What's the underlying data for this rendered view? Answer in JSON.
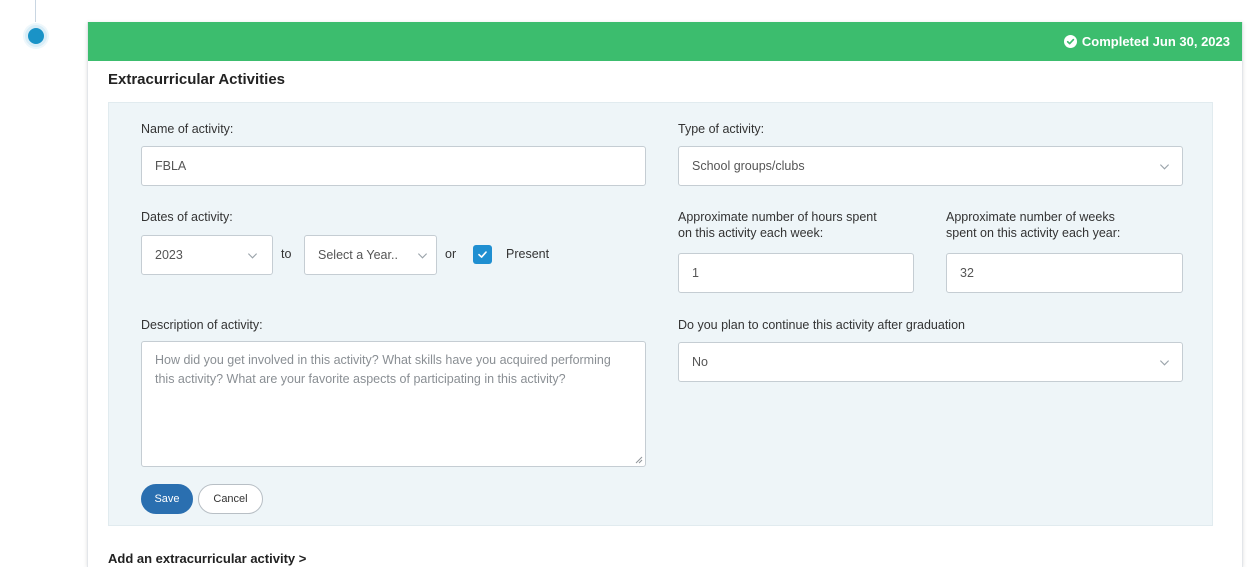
{
  "status": {
    "label": "Completed Jun 30, 2023",
    "color": "#3cbd6e",
    "icon": "check-circle-icon"
  },
  "section": {
    "title": "Extracurricular Activities"
  },
  "form": {
    "name": {
      "label": "Name of activity:",
      "value": "FBLA"
    },
    "type": {
      "label": "Type of activity:",
      "value": "School groups/clubs"
    },
    "dates": {
      "label": "Dates of activity:",
      "start_value": "2023",
      "to_text": "to",
      "end_placeholder": "Select a Year..",
      "or_text": "or",
      "present_label": "Present",
      "present_checked": true
    },
    "hours": {
      "label_line1": "Approximate number of hours spent",
      "label_line2": "on this activity each week:",
      "value": "1"
    },
    "weeks": {
      "label_line1": "Approximate number of weeks",
      "label_line2": "spent on this activity each year:",
      "value": "32"
    },
    "description": {
      "label": "Description of activity:",
      "placeholder": "How did you get involved in this activity? What skills have you acquired performing this activity? What are your favorite aspects of participating in this activity?"
    },
    "continue": {
      "label": "Do you plan to continue this activity after graduation",
      "value": "No"
    }
  },
  "buttons": {
    "save": "Save",
    "cancel": "Cancel"
  },
  "add_link": "Add an extracurricular activity >",
  "colors": {
    "accent": "#1f8fd1",
    "save_button": "#2a6fb0",
    "panel": "#eef5f8",
    "timeline_dot": "#1a93c7"
  }
}
